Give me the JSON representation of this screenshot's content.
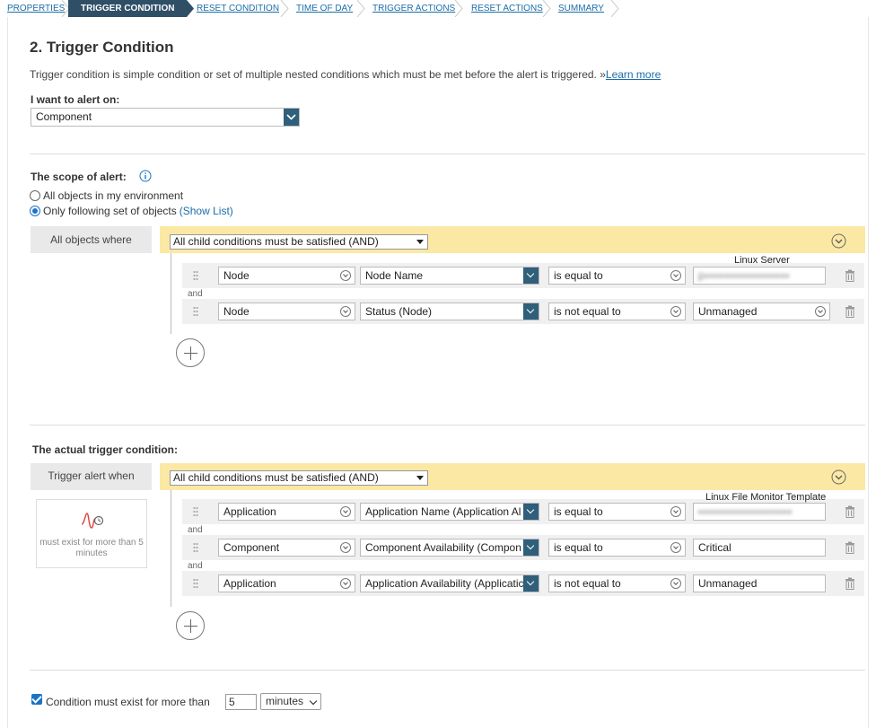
{
  "steps": [
    "PROPERTIES",
    "TRIGGER CONDITION",
    "RESET CONDITION",
    "TIME OF DAY",
    "TRIGGER ACTIONS",
    "RESET ACTIONS",
    "SUMMARY"
  ],
  "active_step": "TRIGGER CONDITION",
  "title": "2. Trigger Condition",
  "description": "Trigger condition is simple condition or set of multiple nested conditions which must be met before the alert is triggered.",
  "learn_more_prefix": "»",
  "learn_more": "Learn more",
  "alert_on": {
    "label": "I want to alert on:",
    "value": "Component"
  },
  "scope": {
    "label": "The scope of alert:",
    "info_icon": "info-icon",
    "option_all": "All objects in my environment",
    "option_following": "Only following set of objects",
    "show_list": "(Show List)",
    "selected": "following",
    "where_label": "All objects where",
    "group_operator": "All child conditions must be satisfied (AND)",
    "and_label": "and",
    "conditions": [
      {
        "entity": "Node",
        "field": "Node Name",
        "operator": "is equal to",
        "value": "p▪▪▪▪▪▪▪▪▪▪▪▪▪▪▪▪▪▪",
        "value_blurred": true,
        "overlay": "Linux Server"
      },
      {
        "entity": "Node",
        "field": "Status (Node)",
        "operator": "is not equal to",
        "value": "Unmanaged",
        "value_blurred": false,
        "overlay": ""
      }
    ]
  },
  "trigger": {
    "label": "The actual trigger condition:",
    "when_label": "Trigger alert when",
    "group_operator": "All child conditions must be satisfied (AND)",
    "and_label": "and",
    "side_card_text": "must exist for more than 5 minutes",
    "conditions": [
      {
        "entity": "Application",
        "field": "Application Name (Application Al",
        "operator": "is equal to",
        "value": "▪▪▪▪▪▪▪▪▪▪▪▪▪▪▪▪▪▪▪▪",
        "value_blurred": true,
        "overlay": "Linux File Monitor Template"
      },
      {
        "entity": "Component",
        "field": "Component Availability (Compon",
        "operator": "is equal to",
        "value": "Critical",
        "value_blurred": false,
        "overlay": ""
      },
      {
        "entity": "Application",
        "field": "Application Availability (Applicatic",
        "operator": "is not equal to",
        "value": "Unmanaged",
        "value_blurred": false,
        "overlay": ""
      }
    ]
  },
  "duration": {
    "label": "Condition must exist for more than",
    "checked": true,
    "value": "5",
    "unit": "minutes"
  },
  "colors": {
    "accent": "#2f5f7a",
    "link": "#1a6ea8",
    "group_bar": "#fbe8a4",
    "active_step": "#2f4f66"
  }
}
